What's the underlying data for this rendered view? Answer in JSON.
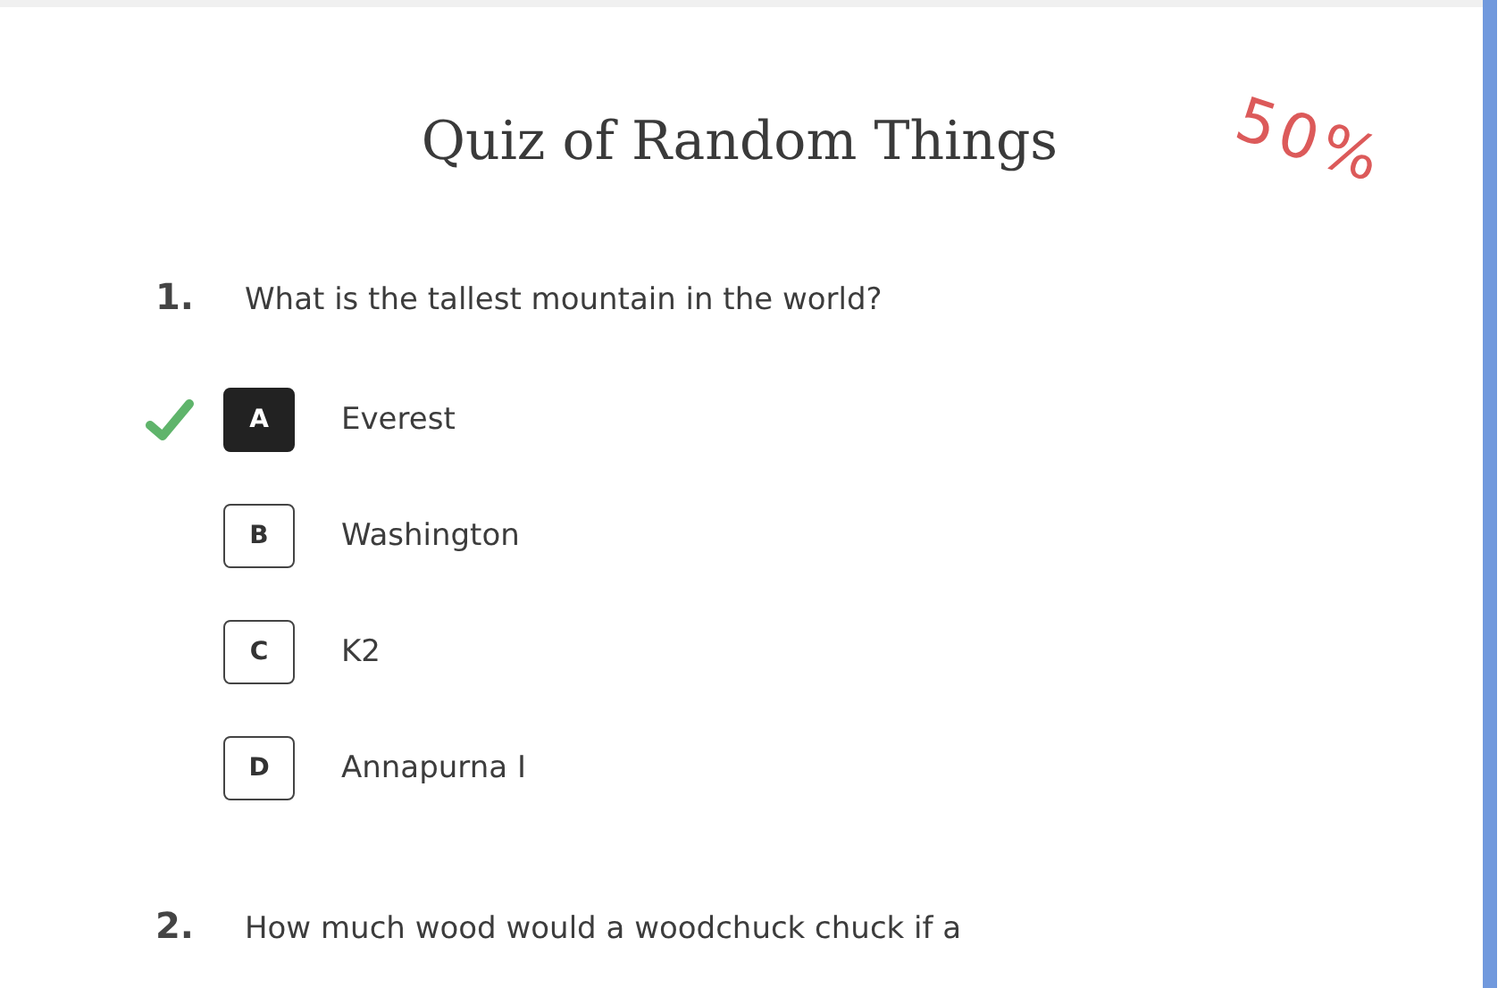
{
  "quiz": {
    "title": "Quiz of Random Things",
    "score": "50%"
  },
  "questions": [
    {
      "number": "1.",
      "text": "What is the tallest mountain in the world?",
      "options": [
        {
          "letter": "A",
          "text": "Everest",
          "selected": true,
          "correct": true
        },
        {
          "letter": "B",
          "text": "Washington",
          "selected": false,
          "correct": false
        },
        {
          "letter": "C",
          "text": "K2",
          "selected": false,
          "correct": false
        },
        {
          "letter": "D",
          "text": "Annapurna I",
          "selected": false,
          "correct": false
        }
      ]
    },
    {
      "number": "2.",
      "text": "How much wood would a woodchuck chuck if a"
    }
  ]
}
